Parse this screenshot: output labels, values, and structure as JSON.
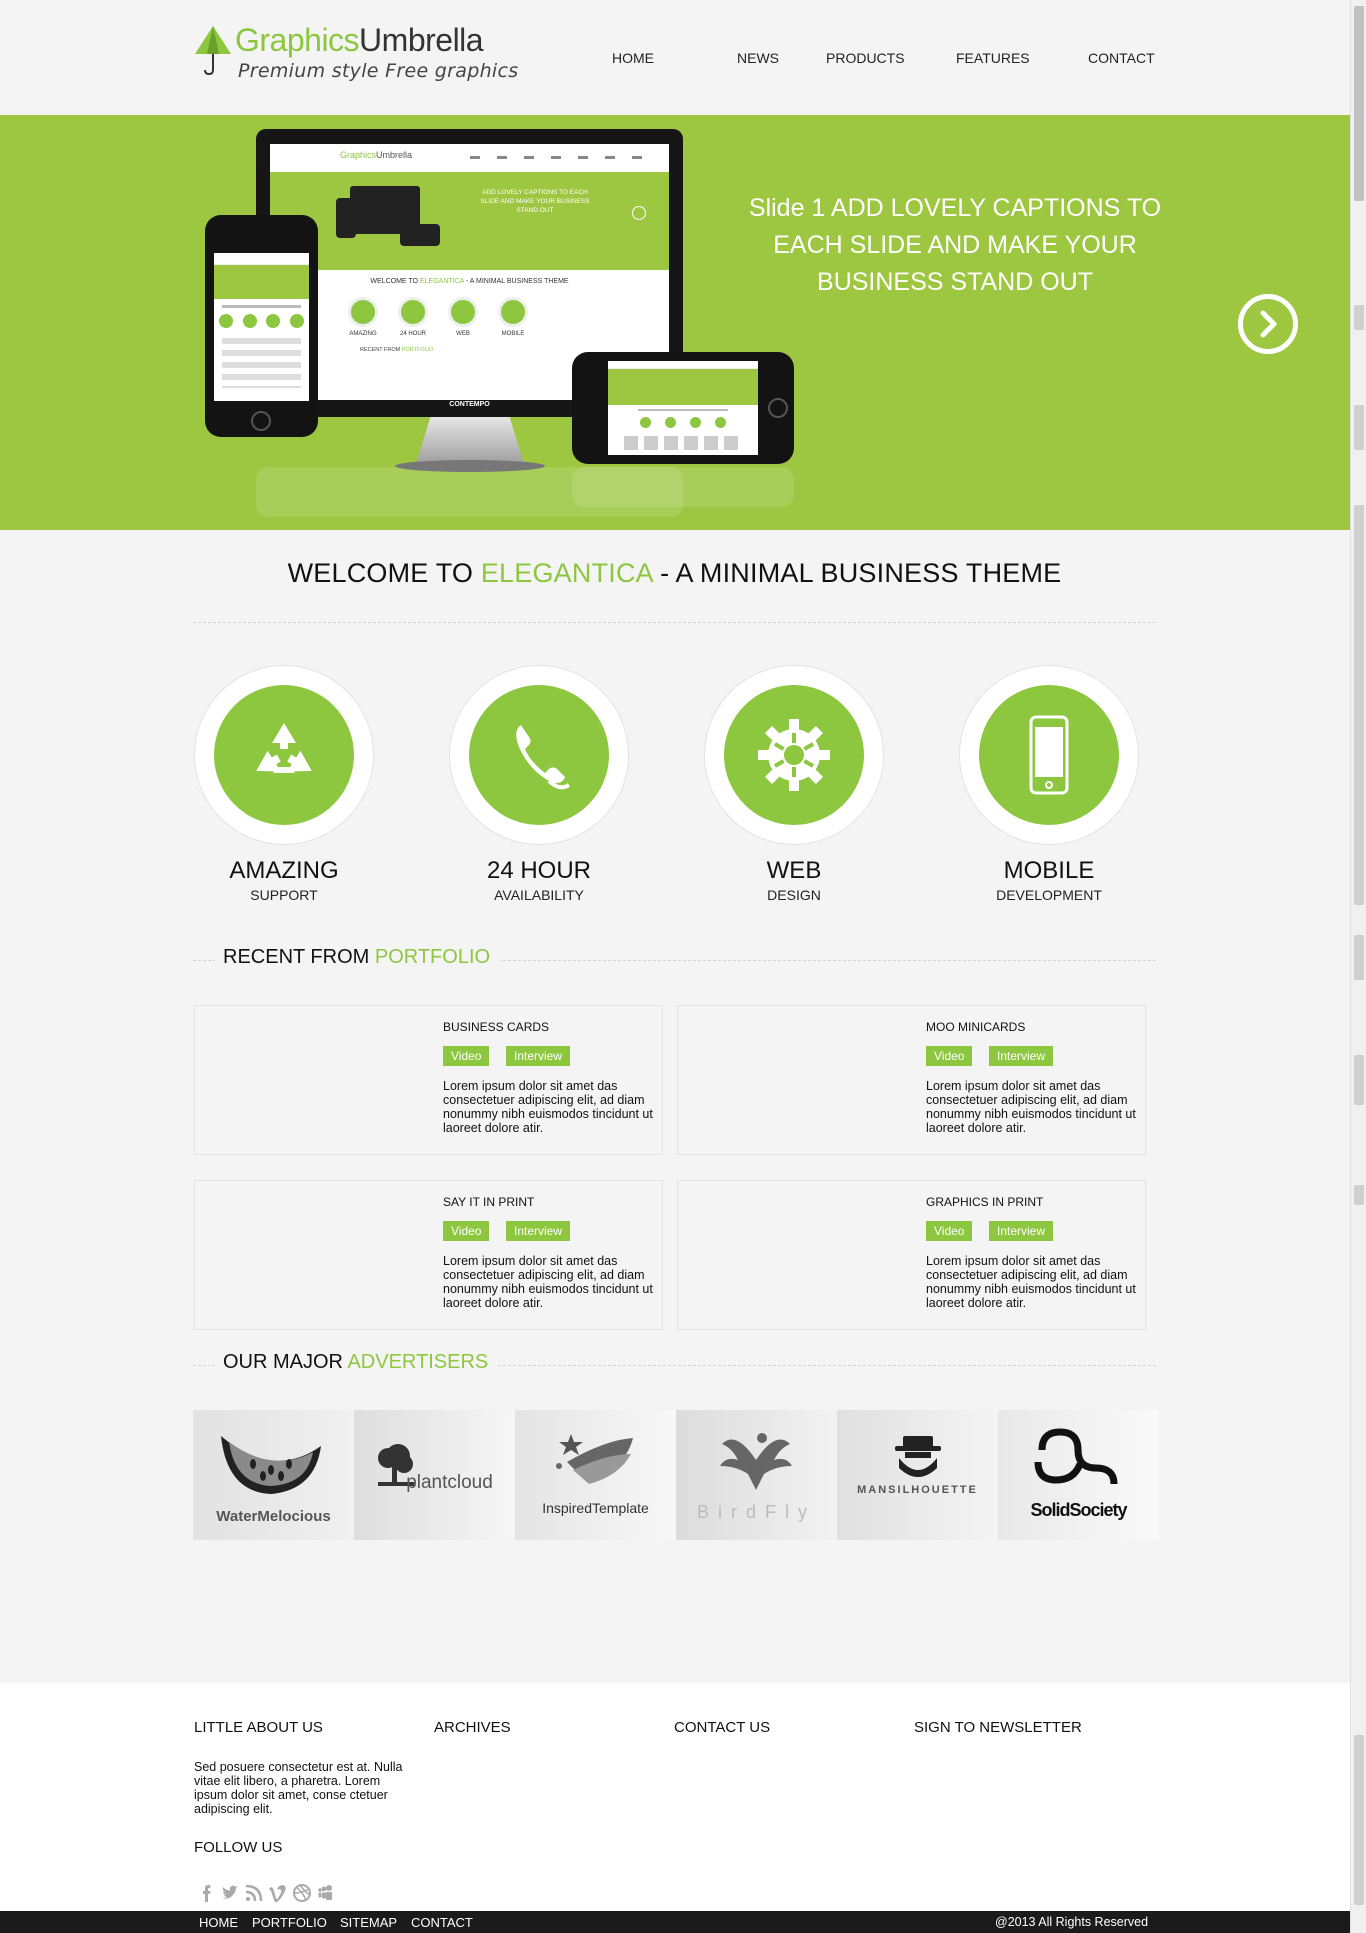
{
  "brand": {
    "name_part1": "Graphics",
    "name_part2": "Umbrella",
    "tagline": "Premium style Free graphics",
    "accent": "#8dc63f",
    "hero_bg": "#9dc641"
  },
  "nav": {
    "items": [
      "HOME",
      "NEWS",
      "PRODUCTS",
      "FEATURES",
      "CONTACT"
    ]
  },
  "hero": {
    "caption": "Slide 1 ADD LOVELY CAPTIONS TO EACH SLIDE AND MAKE YOUR BUSINESS STAND OUT",
    "next_icon": "chevron-right-circle-icon",
    "mock": {
      "logo_part1": "Graphics",
      "logo_part2": "Umbrella",
      "caption": "ADD LOVELY CAPTIONS TO EACH SLIDE AND MAKE YOUR BUSINESS STAND OUT",
      "welcome_pre": "WELCOME TO",
      "welcome_hl": "ELEGANTICA",
      "welcome_post": " - A MINIMAL BUSINESS THEME",
      "labels": [
        "AMAZING",
        "24 HOUR",
        "WEB",
        "MOBILE"
      ],
      "recent_pre": "RECENT FROM",
      "recent_hl": "PORTFOLIO",
      "brand_on_monitor": "CONTEMPO"
    }
  },
  "welcome": {
    "prefix": "WELCOME TO ",
    "highlight": "ELEGANTICA",
    "suffix": " - A MINIMAL BUSINESS THEME"
  },
  "features": [
    {
      "title": "AMAZING",
      "subtitle": "SUPPORT",
      "icon": "recycle-icon"
    },
    {
      "title": "24 HOUR",
      "subtitle": "AVAILABILITY",
      "icon": "phone-icon"
    },
    {
      "title": "WEB",
      "subtitle": "DESIGN",
      "icon": "gear-icon"
    },
    {
      "title": "MOBILE",
      "subtitle": "DEVELOPMENT",
      "icon": "mobile-phone-icon"
    }
  ],
  "portfolio": {
    "heading_prefix": "RECENT FROM ",
    "heading_highlight": "PORTFOLIO",
    "items": [
      {
        "title": "BUSINESS CARDS",
        "tag1": "Video",
        "tag2": "Interview",
        "text": "Lorem ipsum dolor sit amet das consectetuer adipiscing elit, ad diam nonummy nibh euismodos tincidunt ut laoreet dolore atir."
      },
      {
        "title": "MOO MINICARDS",
        "tag1": "Video",
        "tag2": "Interview",
        "text": "Lorem ipsum dolor sit amet das consectetuer adipiscing elit, ad diam nonummy nibh euismodos tincidunt ut laoreet dolore atir."
      },
      {
        "title": "SAY IT IN PRINT",
        "tag1": "Video",
        "tag2": "Interview",
        "text": "Lorem ipsum dolor sit amet das consectetuer adipiscing elit, ad diam nonummy nibh euismodos tincidunt ut laoreet dolore atir."
      },
      {
        "title": "GRAPHICS IN PRINT",
        "tag1": "Video",
        "tag2": "Interview",
        "text": "Lorem ipsum dolor sit amet das consectetuer adipiscing elit, ad diam nonummy nibh euismodos tincidunt ut laoreet dolore atir."
      }
    ]
  },
  "advertisers": {
    "heading_prefix": "OUR MAJOR ",
    "heading_highlight": "ADVERTISERS",
    "logos": [
      "WaterMelocious",
      "plantcloud",
      "InspiredTemplate",
      "BirdFly",
      "MANSILHOUETTE",
      "SolidSociety"
    ]
  },
  "footer": {
    "columns": [
      "LITTLE ABOUT US",
      "ARCHIVES",
      "CONTACT US",
      "SIGN TO NEWSLETTER"
    ],
    "about_text": "Sed posuere consectetur est at. Nulla vitae elit libero, a pharetra. Lorem ipsum dolor sit amet, conse ctetuer adipiscing elit.",
    "follow_label": "FOLLOW US",
    "socials": [
      "facebook-icon",
      "twitter-icon",
      "rss-icon",
      "vimeo-icon",
      "dribbble-icon",
      "myspace-icon"
    ],
    "bottom_links": [
      "HOME",
      "PORTFOLIO",
      "SITEMAP",
      "CONTACT"
    ],
    "copyright": "@2013 All Rights Reserved"
  }
}
